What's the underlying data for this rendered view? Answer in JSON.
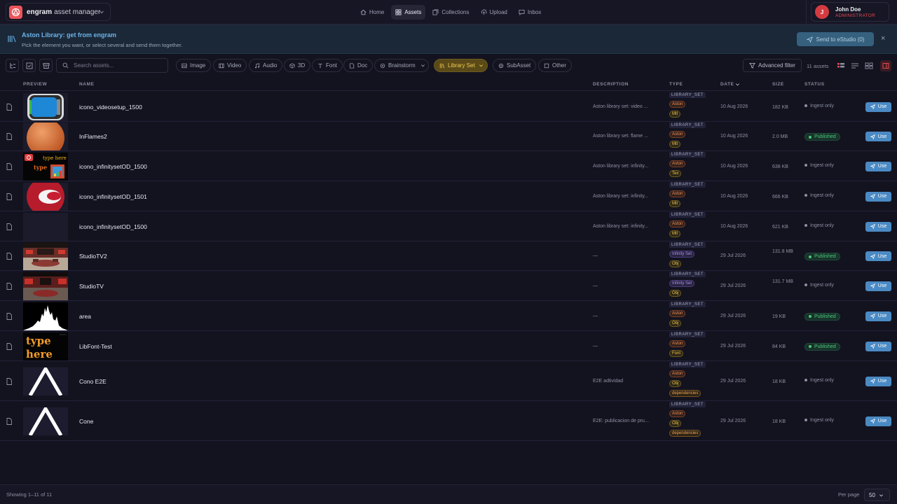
{
  "app": {
    "brand_name": "engram",
    "brand_sub": "asset manager"
  },
  "nav": [
    {
      "label": "Home",
      "icon": "home-icon"
    },
    {
      "label": "Assets",
      "icon": "grid-icon",
      "active": true
    },
    {
      "label": "Collections",
      "icon": "collections-icon"
    },
    {
      "label": "Upload",
      "icon": "upload-icon"
    },
    {
      "label": "Inbox",
      "icon": "inbox-icon"
    }
  ],
  "user": {
    "initial": "J",
    "name": "John Doe",
    "role": "ADMINISTRATOR"
  },
  "banner": {
    "title": "Aston Library: get from engram",
    "subtitle": "Pick the element you want, or select several and send them together.",
    "send_label": "Send to eStudio (0)",
    "close": "×"
  },
  "toolbar": {
    "search_placeholder": "Search assets...",
    "filters": [
      "Image",
      "Video",
      "Audio",
      "3D",
      "Font",
      "Doc",
      "Brainstorm",
      "Library Set",
      "SubAsset",
      "Other"
    ],
    "active_filter": "Library Set",
    "advanced_filter": "Advanced filter",
    "asset_count": "11 assets"
  },
  "columns": {
    "preview": "PREVIEW",
    "name": "NAME",
    "description": "DESCRIPTION",
    "type": "TYPE",
    "date": "DATE",
    "size": "SIZE",
    "status": "STATUS"
  },
  "rows": [
    {
      "name": "icono_videosetup_1500",
      "desc": "Aston library set: video ...",
      "lib": "LIBRARY_SET",
      "tags": [
        "Aston",
        "Mtl"
      ],
      "date": "10 Aug 2026",
      "size": "182 KB",
      "status": "Ingest only",
      "use": "Use"
    },
    {
      "name": "InFlames2",
      "desc": "Aston library set: flame ...",
      "lib": "LIBRARY_SET",
      "tags": [
        "Aston",
        "Mtl"
      ],
      "date": "10 Aug 2026",
      "size": "2.0 MB",
      "status": "Published",
      "use": "Use"
    },
    {
      "name": "icono_infinitysetOD_1500",
      "desc": "Aston library set: infinity...",
      "lib": "LIBRARY_SET",
      "tags": [
        "Aston",
        "Tex"
      ],
      "date": "10 Aug 2026",
      "size": "638 KB",
      "status": "Ingest only",
      "use": "Use"
    },
    {
      "name": "icono_infinitysetOD_1501",
      "desc": "Aston library set: infinity...",
      "lib": "LIBRARY_SET",
      "tags": [
        "Aston",
        "Mtl"
      ],
      "date": "10 Aug 2026",
      "size": "666 KB",
      "status": "Ingest only",
      "use": "Use"
    },
    {
      "name": "icono_infinitysetOD_1500",
      "desc": "Aston library set: infinity...",
      "lib": "LIBRARY_SET",
      "tags": [
        "Aston",
        "Mtl"
      ],
      "date": "10 Aug 2026",
      "size": "621 KB",
      "status": "Ingest only",
      "use": "Use"
    },
    {
      "name": "StudioTV2",
      "desc": "—",
      "lib": "LIBRARY_SET",
      "tags": [
        "Infinity Set",
        "Obj"
      ],
      "date": "29 Jul 2026",
      "size": "131.8 MB",
      "status": "Published",
      "use": "Use"
    },
    {
      "name": "StudioTV",
      "desc": "—",
      "lib": "LIBRARY_SET",
      "tags": [
        "Infinity Set",
        "Obj"
      ],
      "date": "29 Jul 2026",
      "size": "131.7 MB",
      "status": "Ingest only",
      "use": "Use"
    },
    {
      "name": "area",
      "desc": "—",
      "lib": "LIBRARY_SET",
      "tags": [
        "Aston",
        "Obj"
      ],
      "date": "29 Jul 2026",
      "size": "19 KB",
      "status": "Published",
      "use": "Use"
    },
    {
      "name": "LibFont-Test",
      "desc": "—",
      "lib": "LIBRARY_SET",
      "tags": [
        "Aston",
        "Font"
      ],
      "date": "29 Jul 2026",
      "size": "84 KB",
      "status": "Published",
      "use": "Use"
    },
    {
      "name": "Cono E2E",
      "desc": "E2E adtividad",
      "lib": "LIBRARY_SET",
      "tags": [
        "Aston",
        "Obj",
        "dependencies"
      ],
      "date": "29 Jul 2026",
      "size": "18 KB",
      "status": "Ingest only",
      "use": "Use"
    },
    {
      "name": "Cone",
      "desc": "E2E: publicacion de pru...",
      "lib": "LIBRARY_SET",
      "tags": [
        "Aston",
        "Obj",
        "dependencies"
      ],
      "date": "29 Jul 2026",
      "size": "18 KB",
      "status": "Ingest only",
      "use": "Use"
    }
  ],
  "thumb_text": {
    "type": "type",
    "here": "here",
    "type_here": "type here"
  },
  "footer": {
    "showing": "Showing 1–11 of 11",
    "per_page_label": "Per page",
    "per_page_value": "50"
  }
}
